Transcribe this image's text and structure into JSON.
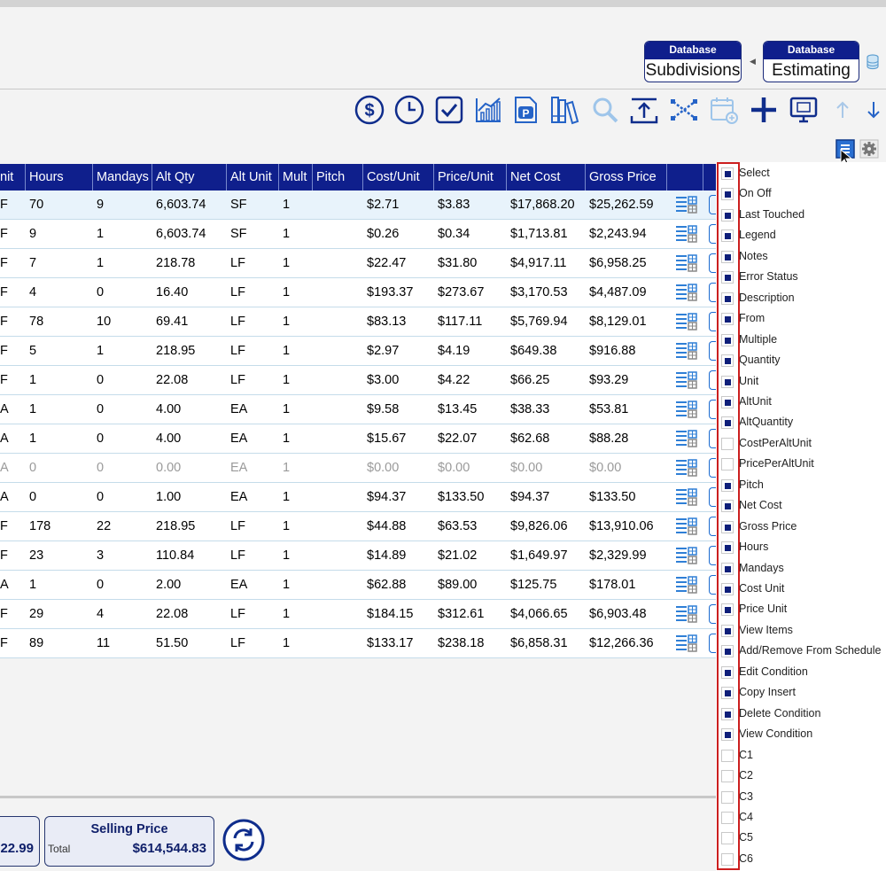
{
  "header": {
    "db_buttons": [
      {
        "header": "Database",
        "label": "Subdivisions"
      },
      {
        "header": "Database",
        "label": "Estimating"
      }
    ]
  },
  "toolbar": {
    "icons": [
      "dollar-icon",
      "clock-icon",
      "checkbox-icon",
      "chart-icon",
      "pdf-icon",
      "books-icon",
      "search-icon",
      "export-icon",
      "shuffle-icon",
      "calendar-add-icon",
      "add-icon",
      "monitor-icon",
      "arrow-up-icon",
      "arrow-down-icon"
    ]
  },
  "grid": {
    "columns": [
      "nit",
      "Hours",
      "Mandays",
      "Alt Qty",
      "Alt Unit",
      "Mult",
      "Pitch",
      "Cost/Unit",
      "Price/Unit",
      "Net Cost",
      "Gross Price"
    ],
    "rows": [
      [
        "F",
        "70",
        "9",
        "6,603.74",
        "SF",
        "1",
        "",
        "$2.71",
        "$3.83",
        "$17,868.20",
        "$25,262.59"
      ],
      [
        "F",
        "9",
        "1",
        "6,603.74",
        "SF",
        "1",
        "",
        "$0.26",
        "$0.34",
        "$1,713.81",
        "$2,243.94"
      ],
      [
        "F",
        "7",
        "1",
        "218.78",
        "LF",
        "1",
        "",
        "$22.47",
        "$31.80",
        "$4,917.11",
        "$6,958.25"
      ],
      [
        "F",
        "4",
        "0",
        "16.40",
        "LF",
        "1",
        "",
        "$193.37",
        "$273.67",
        "$3,170.53",
        "$4,487.09"
      ],
      [
        "F",
        "78",
        "10",
        "69.41",
        "LF",
        "1",
        "",
        "$83.13",
        "$117.11",
        "$5,769.94",
        "$8,129.01"
      ],
      [
        "F",
        "5",
        "1",
        "218.95",
        "LF",
        "1",
        "",
        "$2.97",
        "$4.19",
        "$649.38",
        "$916.88"
      ],
      [
        "F",
        "1",
        "0",
        "22.08",
        "LF",
        "1",
        "",
        "$3.00",
        "$4.22",
        "$66.25",
        "$93.29"
      ],
      [
        "A",
        "1",
        "0",
        "4.00",
        "EA",
        "1",
        "",
        "$9.58",
        "$13.45",
        "$38.33",
        "$53.81"
      ],
      [
        "A",
        "1",
        "0",
        "4.00",
        "EA",
        "1",
        "",
        "$15.67",
        "$22.07",
        "$62.68",
        "$88.28"
      ],
      [
        "A",
        "0",
        "0",
        "0.00",
        "EA",
        "1",
        "",
        "$0.00",
        "$0.00",
        "$0.00",
        "$0.00"
      ],
      [
        "A",
        "0",
        "0",
        "1.00",
        "EA",
        "1",
        "",
        "$94.37",
        "$133.50",
        "$94.37",
        "$133.50"
      ],
      [
        "F",
        "178",
        "22",
        "218.95",
        "LF",
        "1",
        "",
        "$44.88",
        "$63.53",
        "$9,826.06",
        "$13,910.06"
      ],
      [
        "F",
        "23",
        "3",
        "110.84",
        "LF",
        "1",
        "",
        "$14.89",
        "$21.02",
        "$1,649.97",
        "$2,329.99"
      ],
      [
        "A",
        "1",
        "0",
        "2.00",
        "EA",
        "1",
        "",
        "$62.88",
        "$89.00",
        "$125.75",
        "$178.01"
      ],
      [
        "F",
        "29",
        "4",
        "22.08",
        "LF",
        "1",
        "",
        "$184.15",
        "$312.61",
        "$4,066.65",
        "$6,903.48"
      ],
      [
        "F",
        "89",
        "11",
        "51.50",
        "LF",
        "1",
        "",
        "$133.17",
        "$238.18",
        "$6,858.31",
        "$12,266.36"
      ]
    ]
  },
  "summary": {
    "partial_value": "22.99",
    "selling_price": {
      "title": "Selling Price",
      "sub": "Total",
      "value": "$614,544.83"
    }
  },
  "column_chooser": {
    "options": [
      {
        "label": "Select",
        "checked": true
      },
      {
        "label": "On Off",
        "checked": true
      },
      {
        "label": "Last Touched",
        "checked": true
      },
      {
        "label": "Legend",
        "checked": true
      },
      {
        "label": "Notes",
        "checked": true
      },
      {
        "label": "Error Status",
        "checked": true
      },
      {
        "label": "Description",
        "checked": true
      },
      {
        "label": "From",
        "checked": true
      },
      {
        "label": "Multiple",
        "checked": true
      },
      {
        "label": "Quantity",
        "checked": true
      },
      {
        "label": "Unit",
        "checked": true
      },
      {
        "label": "AltUnit",
        "checked": true
      },
      {
        "label": "AltQuantity",
        "checked": true
      },
      {
        "label": "CostPerAltUnit",
        "checked": false
      },
      {
        "label": "PricePerAltUnit",
        "checked": false
      },
      {
        "label": "Pitch",
        "checked": true
      },
      {
        "label": "Net Cost",
        "checked": true
      },
      {
        "label": "Gross Price",
        "checked": true
      },
      {
        "label": "Hours",
        "checked": true
      },
      {
        "label": "Mandays",
        "checked": true
      },
      {
        "label": "Cost Unit",
        "checked": true
      },
      {
        "label": "Price Unit",
        "checked": true
      },
      {
        "label": "View Items",
        "checked": true
      },
      {
        "label": "Add/Remove From Schedule",
        "checked": true
      },
      {
        "label": "Edit Condition",
        "checked": true
      },
      {
        "label": "Copy Insert",
        "checked": true
      },
      {
        "label": "Delete Condition",
        "checked": true
      },
      {
        "label": "View Condition",
        "checked": true
      },
      {
        "label": "C1",
        "checked": false
      },
      {
        "label": "C2",
        "checked": false
      },
      {
        "label": "C3",
        "checked": false
      },
      {
        "label": "C4",
        "checked": false
      },
      {
        "label": "C5",
        "checked": false
      },
      {
        "label": "C6",
        "checked": false
      }
    ]
  }
}
